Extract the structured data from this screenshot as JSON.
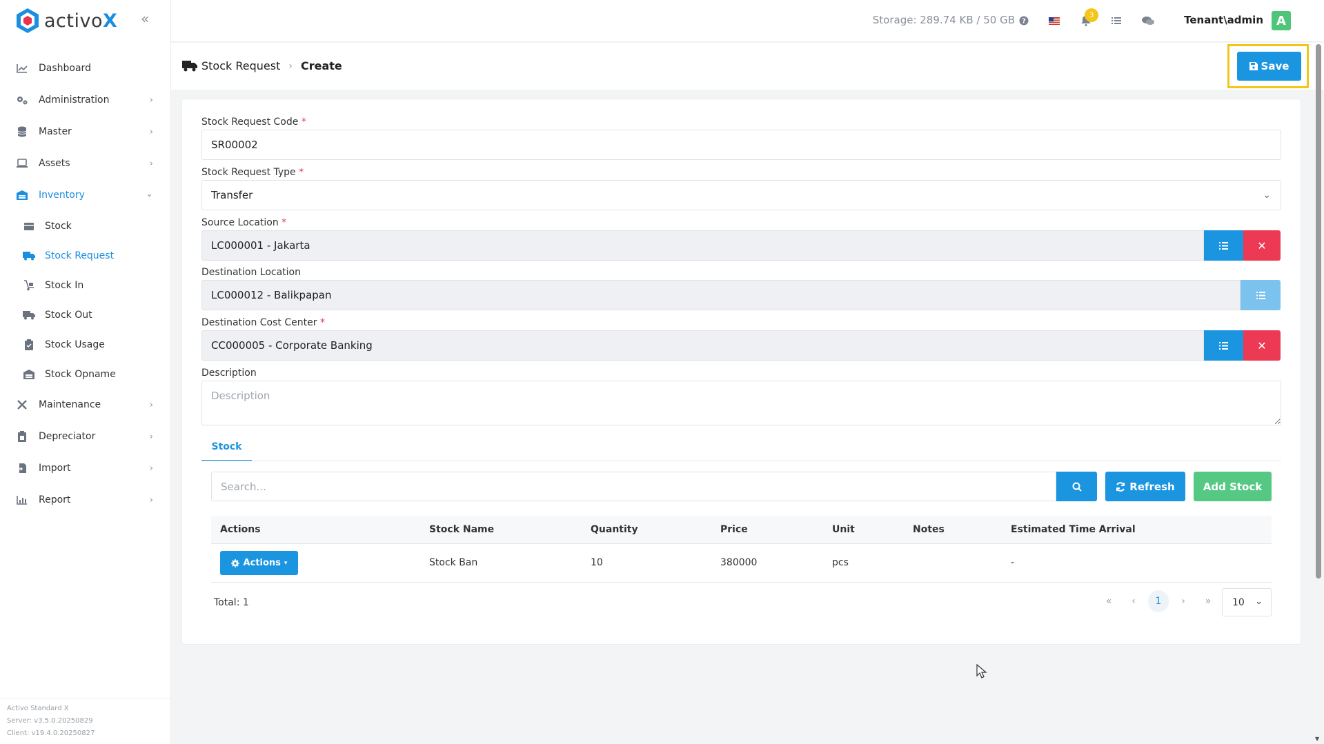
{
  "app": {
    "brand_name": "activo",
    "brand_x": "X"
  },
  "sidebar": {
    "items": [
      {
        "label": "Dashboard",
        "icon": "chart-icon"
      },
      {
        "label": "Administration",
        "icon": "cogs-icon"
      },
      {
        "label": "Master",
        "icon": "database-icon"
      },
      {
        "label": "Assets",
        "icon": "laptop-icon"
      },
      {
        "label": "Inventory",
        "icon": "warehouse-icon"
      },
      {
        "label": "Maintenance",
        "icon": "tools-icon"
      },
      {
        "label": "Depreciator",
        "icon": "clipboard-icon"
      },
      {
        "label": "Import",
        "icon": "file-import-icon"
      },
      {
        "label": "Report",
        "icon": "bar-chart-icon"
      }
    ],
    "inventory_sub": [
      {
        "label": "Stock",
        "icon": "box-icon"
      },
      {
        "label": "Stock Request",
        "icon": "truck-icon"
      },
      {
        "label": "Stock In",
        "icon": "dolly-icon"
      },
      {
        "label": "Stock Out",
        "icon": "truck-moving-icon"
      },
      {
        "label": "Stock Usage",
        "icon": "clipboard-check-icon"
      },
      {
        "label": "Stock Opname",
        "icon": "warehouse-icon"
      }
    ],
    "footer": {
      "product": "Activo Standard X",
      "server": "Server: v3.5.0.20250829",
      "client": "Client: v19.4.0.20250827"
    }
  },
  "topbar": {
    "storage": "Storage: 289.74 KB / 50 GB",
    "notification_count": "3",
    "user": "Tenant\\admin",
    "avatar_initial": "A"
  },
  "page": {
    "breadcrumb_parent": "Stock Request",
    "breadcrumb_current": "Create",
    "save_label": "Save"
  },
  "form": {
    "code_label": "Stock Request Code",
    "code_value": "SR00002",
    "type_label": "Stock Request Type",
    "type_value": "Transfer",
    "source_label": "Source Location",
    "source_value": "LC000001 - Jakarta",
    "dest_label": "Destination Location",
    "dest_value": "LC000012 - Balikpapan",
    "cost_label": "Destination Cost Center",
    "cost_value": "CC000005 - Corporate Banking",
    "desc_label": "Description",
    "desc_placeholder": "Description",
    "required_mark": "*"
  },
  "tabs": {
    "stock": "Stock"
  },
  "table": {
    "search_placeholder": "Search...",
    "refresh_label": "Refresh",
    "add_label": "Add Stock",
    "columns": [
      "Actions",
      "Stock Name",
      "Quantity",
      "Price",
      "Unit",
      "Notes",
      "Estimated Time Arrival"
    ],
    "rows": [
      {
        "actions": "Actions",
        "stock_name": "Stock Ban",
        "quantity": "10",
        "price": "380000",
        "unit": "pcs",
        "notes": "",
        "eta": "-"
      }
    ],
    "total": "Total: 1",
    "current_page": "1",
    "page_size": "10"
  },
  "colors": {
    "primary": "#1b95e0",
    "danger": "#ec3a55",
    "success": "#55c983",
    "highlight": "#f2c518"
  }
}
